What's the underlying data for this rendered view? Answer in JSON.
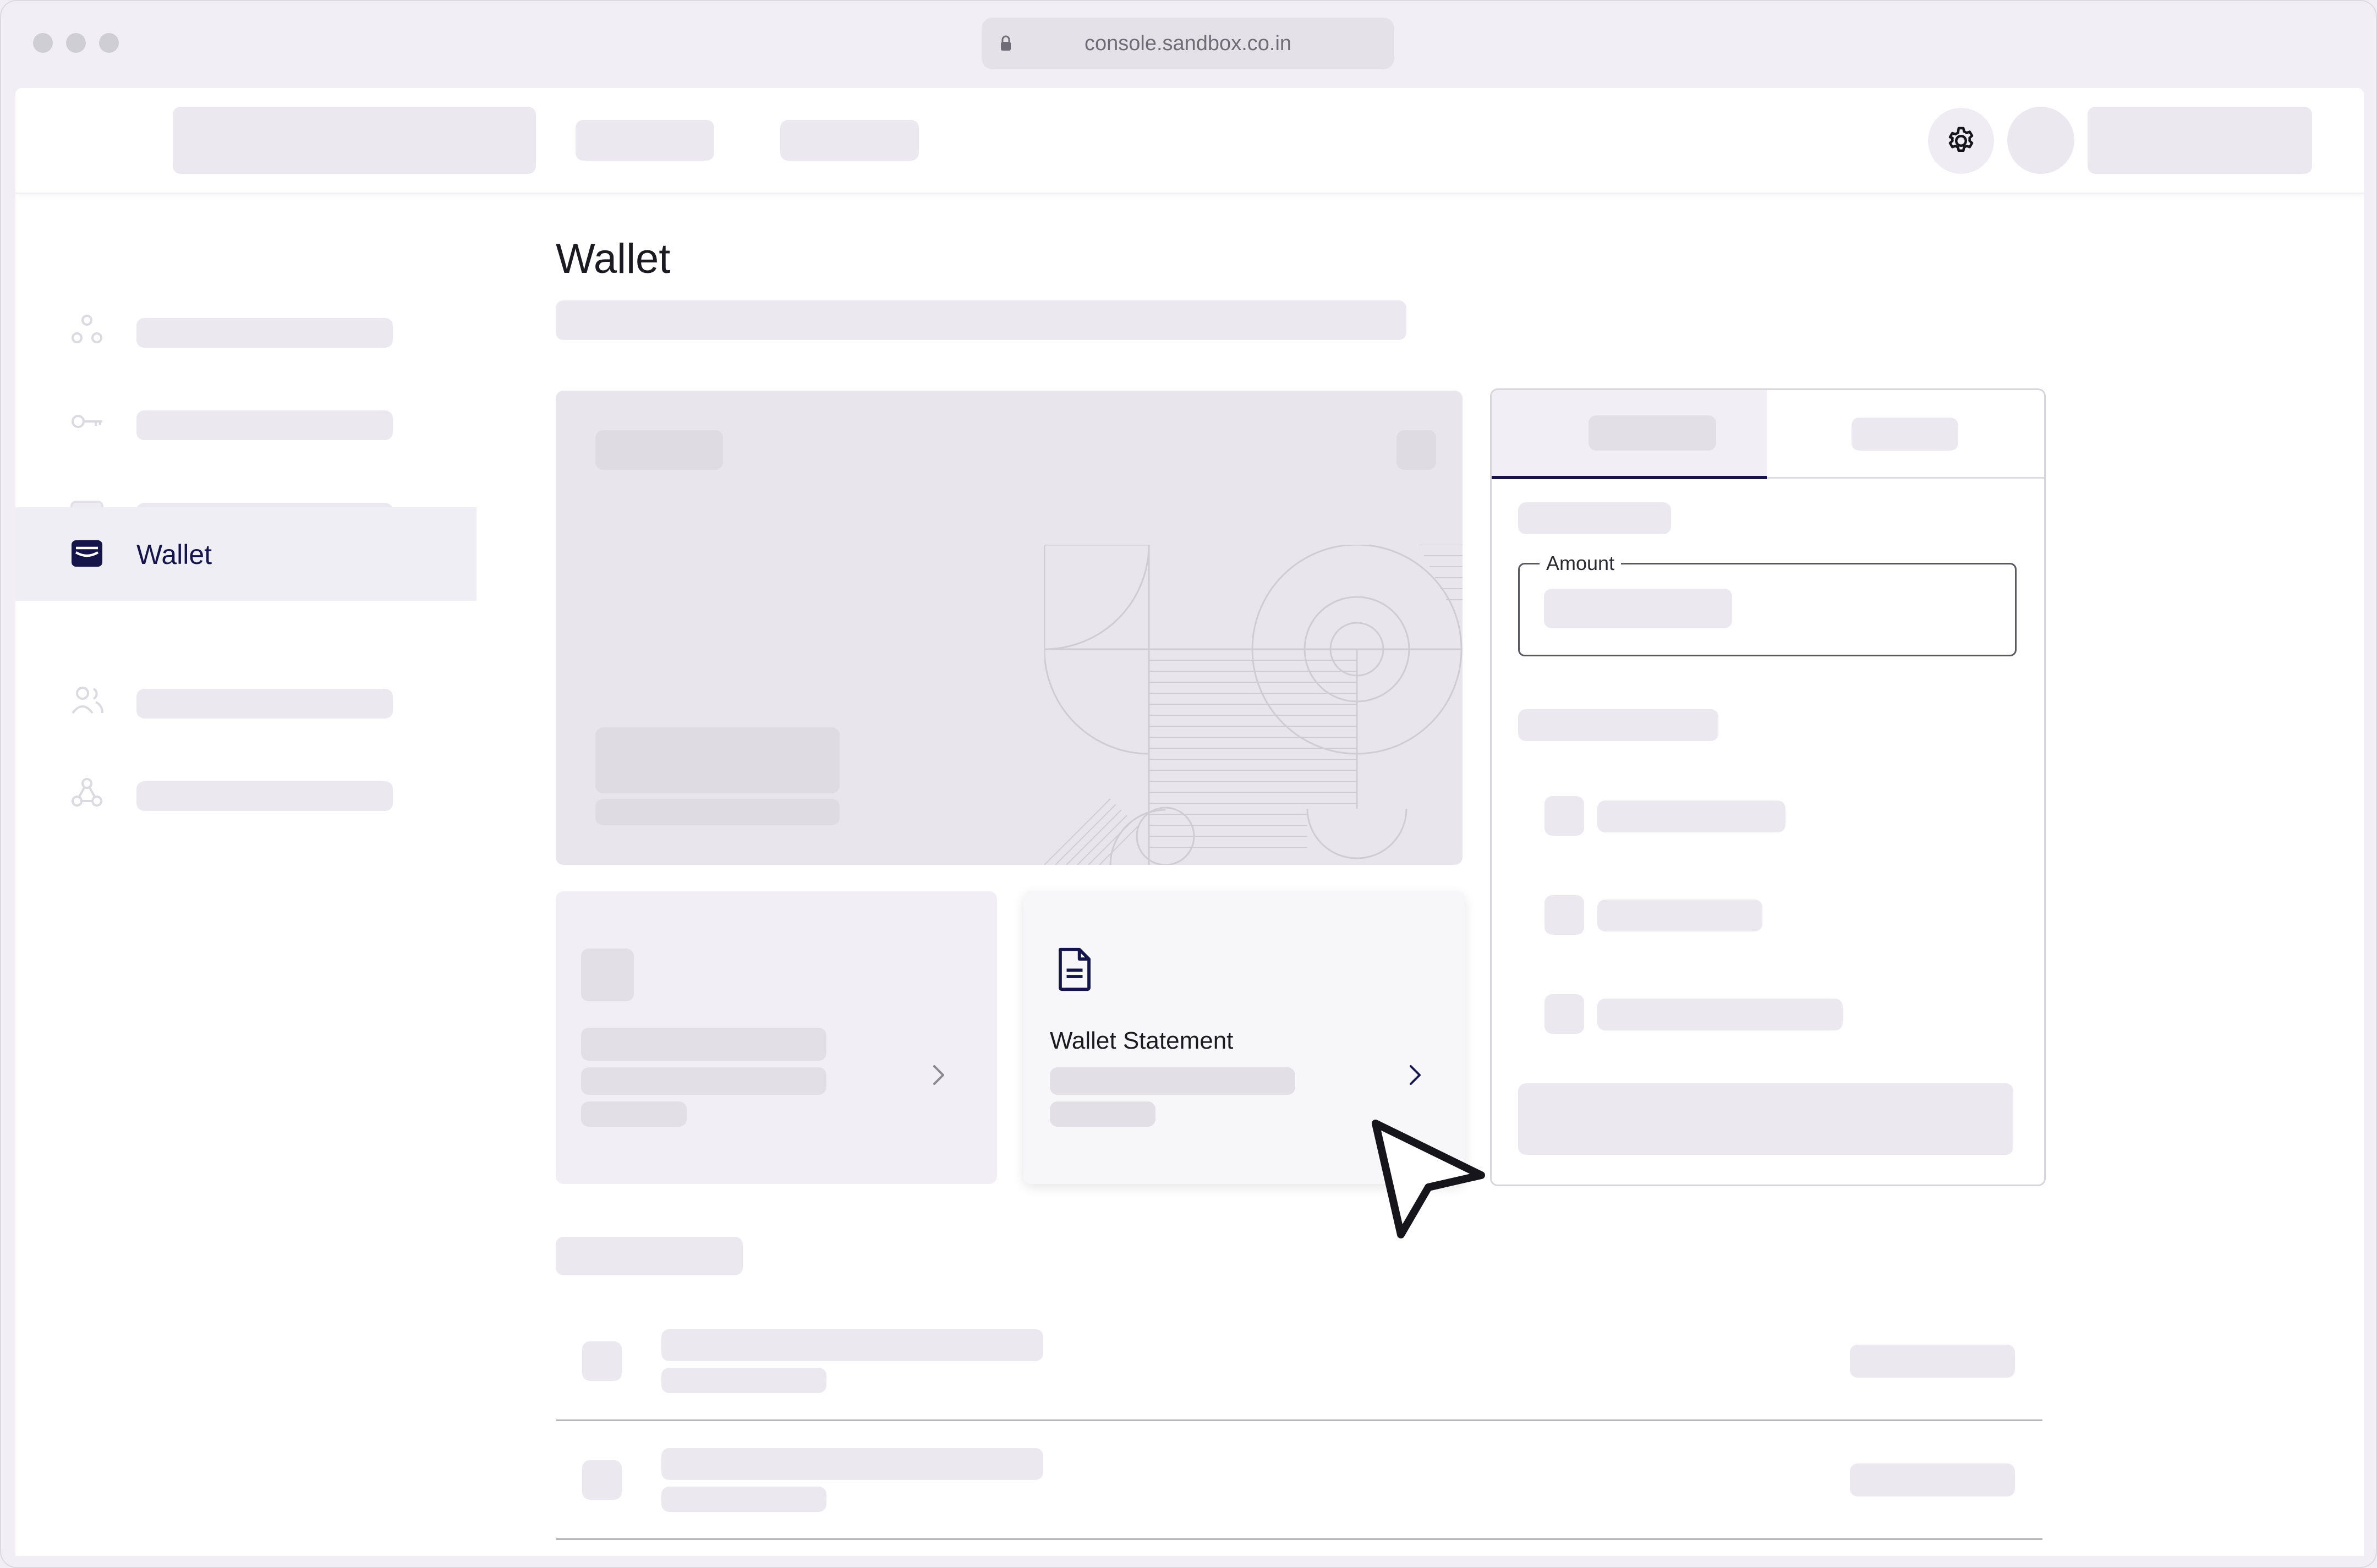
{
  "browser": {
    "url": "console.sandbox.co.in"
  },
  "sidebar": {
    "items": [
      {
        "icon": "circles-icon",
        "label": ""
      },
      {
        "icon": "key-icon",
        "label": ""
      },
      {
        "icon": "card-icon",
        "label": ""
      },
      {
        "icon": "wallet-icon",
        "label": "Wallet",
        "active": true
      },
      {
        "icon": "users-icon",
        "label": ""
      },
      {
        "icon": "webhook-icon",
        "label": ""
      }
    ]
  },
  "page": {
    "title": "Wallet"
  },
  "tiles": {
    "statement_label": "Wallet Statement",
    "statement_icon": "document-icon"
  },
  "panel": {
    "amount_label": "Amount"
  },
  "colors": {
    "accent": "#16154a",
    "skeleton": "#ebe9ef",
    "background": "#f1eff5"
  }
}
